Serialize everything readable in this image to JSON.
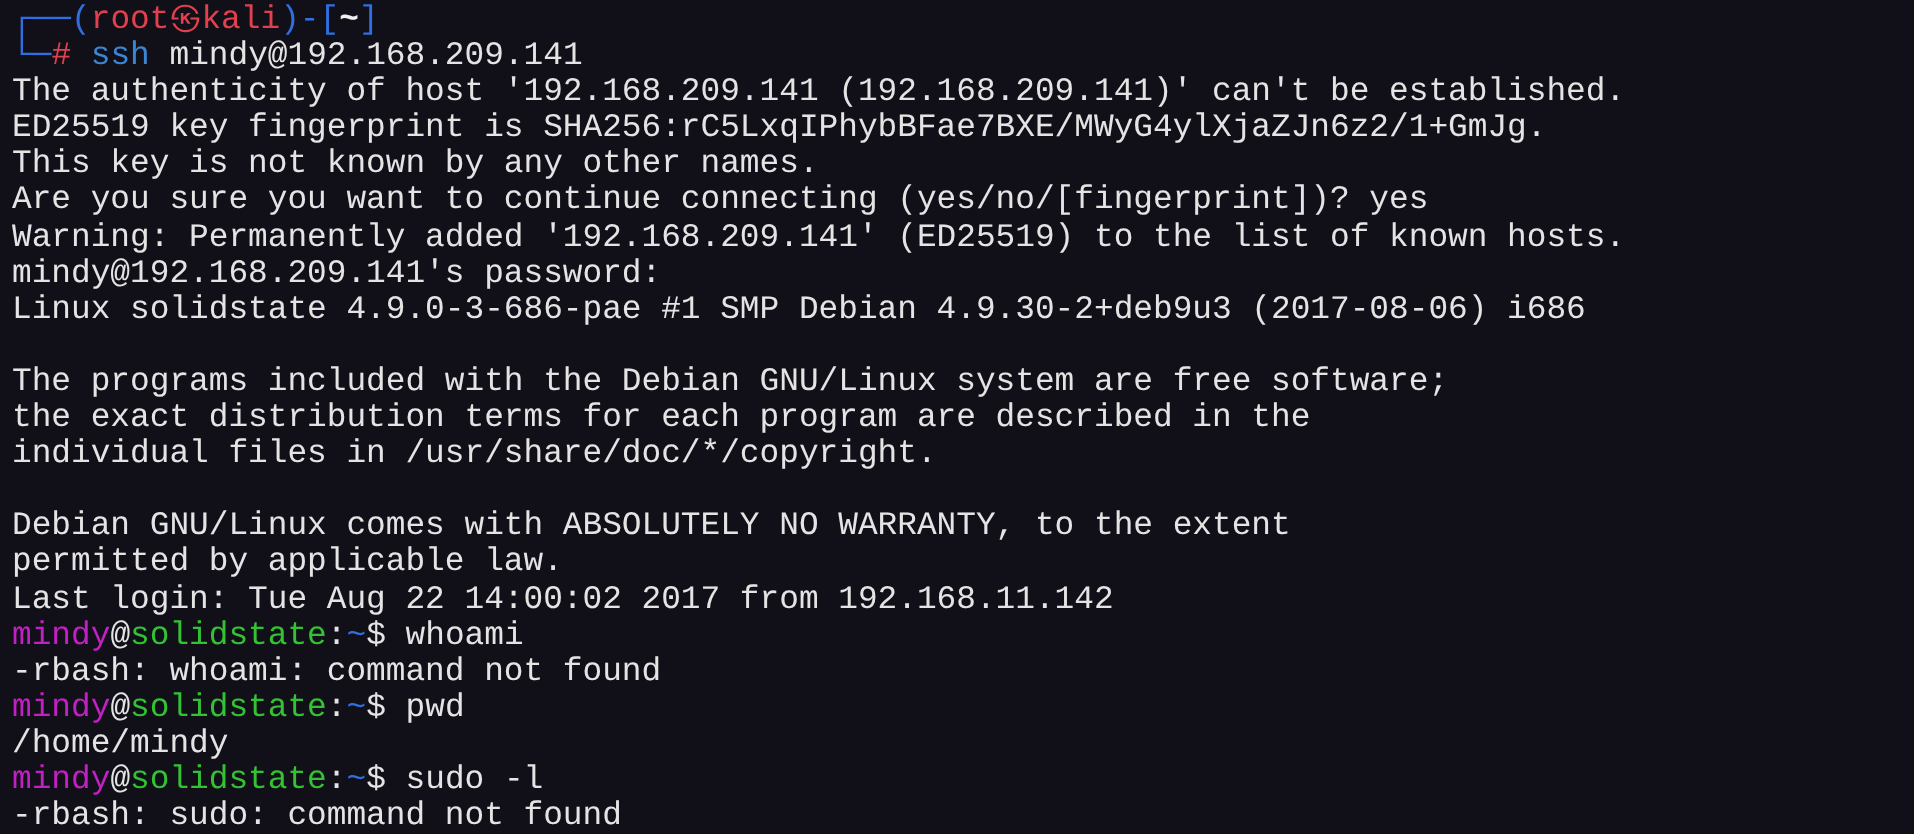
{
  "lines": [
    {
      "kind": "kali_prompt",
      "frame_open": "┌──(",
      "user": "root",
      "at": "㉿",
      "host": "kali",
      "frame_mid": ")-[",
      "dir": "~",
      "frame_close": "]"
    },
    {
      "kind": "kali_command",
      "frame": "└─",
      "sigil": "#",
      "program": "ssh",
      "args": " mindy@192.168.209.141"
    },
    {
      "kind": "output",
      "text": "The authenticity of host '192.168.209.141 (192.168.209.141)' can't be established."
    },
    {
      "kind": "output",
      "text": "ED25519 key fingerprint is SHA256:rC5LxqIPhybBFae7BXE/MWyG4ylXjaZJn6z2/1+GmJg."
    },
    {
      "kind": "output",
      "text": "This key is not known by any other names."
    },
    {
      "kind": "output",
      "text": "Are you sure you want to continue connecting (yes/no/[fingerprint])? yes"
    },
    {
      "kind": "output",
      "text": "Warning: Permanently added '192.168.209.141' (ED25519) to the list of known hosts."
    },
    {
      "kind": "output",
      "text": "mindy@192.168.209.141's password:"
    },
    {
      "kind": "output",
      "text": "Linux solidstate 4.9.0-3-686-pae #1 SMP Debian 4.9.30-2+deb9u3 (2017-08-06) i686"
    },
    {
      "kind": "blank"
    },
    {
      "kind": "output",
      "text": "The programs included with the Debian GNU/Linux system are free software;"
    },
    {
      "kind": "output",
      "text": "the exact distribution terms for each program are described in the"
    },
    {
      "kind": "output",
      "text": "individual files in /usr/share/doc/*/copyright."
    },
    {
      "kind": "blank"
    },
    {
      "kind": "output",
      "text": "Debian GNU/Linux comes with ABSOLUTELY NO WARRANTY, to the extent"
    },
    {
      "kind": "output",
      "text": "permitted by applicable law."
    },
    {
      "kind": "output",
      "text": "Last login: Tue Aug 22 14:00:02 2017 from 192.168.11.142"
    },
    {
      "kind": "remote_prompt",
      "user": "mindy",
      "at": "@",
      "host": "solidstate",
      "sep": ":",
      "path": "~",
      "sigil": "$",
      "command": " whoami"
    },
    {
      "kind": "output",
      "text": "-rbash: whoami: command not found"
    },
    {
      "kind": "remote_prompt",
      "user": "mindy",
      "at": "@",
      "host": "solidstate",
      "sep": ":",
      "path": "~",
      "sigil": "$",
      "command": " pwd"
    },
    {
      "kind": "output",
      "text": "/home/mindy"
    },
    {
      "kind": "remote_prompt",
      "user": "mindy",
      "at": "@",
      "host": "solidstate",
      "sep": ":",
      "path": "~",
      "sigil": "$",
      "command": " sudo -l"
    },
    {
      "kind": "output",
      "text": "-rbash: sudo: command not found"
    }
  ]
}
